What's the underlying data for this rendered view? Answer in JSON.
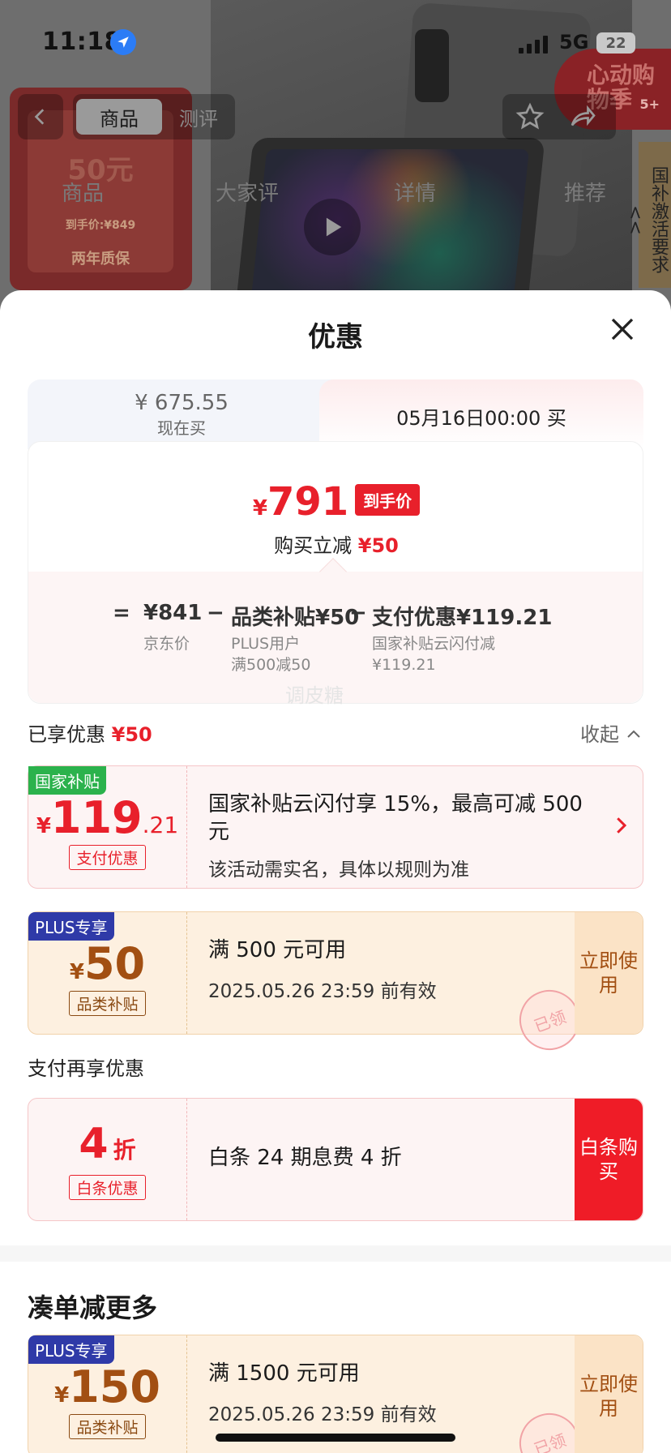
{
  "status_bar": {
    "time": "11:18",
    "network": "5G",
    "battery": "22"
  },
  "background": {
    "tabs": {
      "product": "商品",
      "review": "测评"
    },
    "sub_tabs": [
      "商品",
      "大家评",
      "详情",
      "推荐"
    ],
    "promo": {
      "amount": "50元",
      "price": "到手价:¥849",
      "guarantee": "两年质保"
    },
    "heart_badge": {
      "text": "心动购物季",
      "count": "5+"
    },
    "side_banner": "国补激活要求<<"
  },
  "sheet": {
    "title": "优惠",
    "compare": {
      "now_price": "¥ 675.55",
      "now_label": "现在买",
      "later_label": "05月16日00:00 买",
      "hand_price_yen": "¥",
      "hand_price": "791",
      "hand_price_tag": "到手价",
      "reduce_label": "购买立减",
      "reduce_value": "¥50",
      "formula": {
        "eq": "=",
        "jd_price": "¥841",
        "minus1": "−",
        "cat_subsidy": "品类补贴¥50",
        "minus2": "−",
        "pay_discount": "支付优惠¥119.21",
        "jd_label": "京东价",
        "cat_sub1": "PLUS用户",
        "cat_sub2": "满500减50",
        "pay_sub1": "国家补贴云闪付减",
        "pay_sub2": "¥119.21"
      }
    },
    "watermark": "调皮糖",
    "enjoyed_label": "已享优惠",
    "enjoyed_value": "¥50",
    "collapse_label": "收起",
    "coupons": [
      {
        "badge": "国家补贴",
        "yen": "¥",
        "amount": "119",
        "decimal": ".21",
        "kind": "支付优惠",
        "line1": "国家补贴云闪付享 15%，最高可减 500 元",
        "line2": "该活动需实名，具体以规则为准"
      },
      {
        "badge": "PLUS专享",
        "yen": "¥",
        "amount": "50",
        "kind": "品类补贴",
        "line1": "满 500 元可用",
        "line2": "2025.05.26 23:59 前有效",
        "action": "立即使用",
        "stamp": "已领"
      }
    ],
    "pay_more_label": "支付再享优惠",
    "baitiao": {
      "amount": "4",
      "unit": "折",
      "kind": "白条优惠",
      "line1": "白条 24 期息费 4 折",
      "action": "白条购买"
    },
    "more_title": "凑单减更多",
    "more_coupon": {
      "badge": "PLUS专享",
      "yen": "¥",
      "amount": "150",
      "kind": "品类补贴",
      "line1": "满 1500 元可用",
      "line2": "2025.05.26 23:59 前有效",
      "action": "立即使用",
      "stamp": "已领"
    }
  }
}
